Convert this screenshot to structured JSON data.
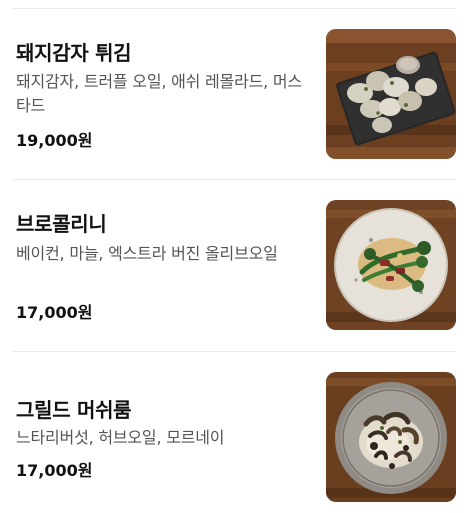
{
  "menu": {
    "items": [
      {
        "name": "돼지감자 튀김",
        "description": "돼지감자, 트러플 오일, 애쉬 레몰라드, 머스타드",
        "price": "19,000원",
        "photo_icon": "fried-sunchoke-dish-photo"
      },
      {
        "name": "브로콜리니",
        "description": "베이컨, 마늘, 엑스트라 버진 올리브오일",
        "price": "17,000원",
        "photo_icon": "broccolini-dish-photo"
      },
      {
        "name": "그릴드 머쉬룸",
        "description": "느타리버섯, 허브오일, 모르네이",
        "price": "17,000원",
        "photo_icon": "grilled-mushroom-dish-photo"
      }
    ]
  },
  "colors": {
    "text_primary": "#111111",
    "text_secondary": "#555555",
    "divider": "#ececec",
    "wood_table": "#7a4a28"
  }
}
